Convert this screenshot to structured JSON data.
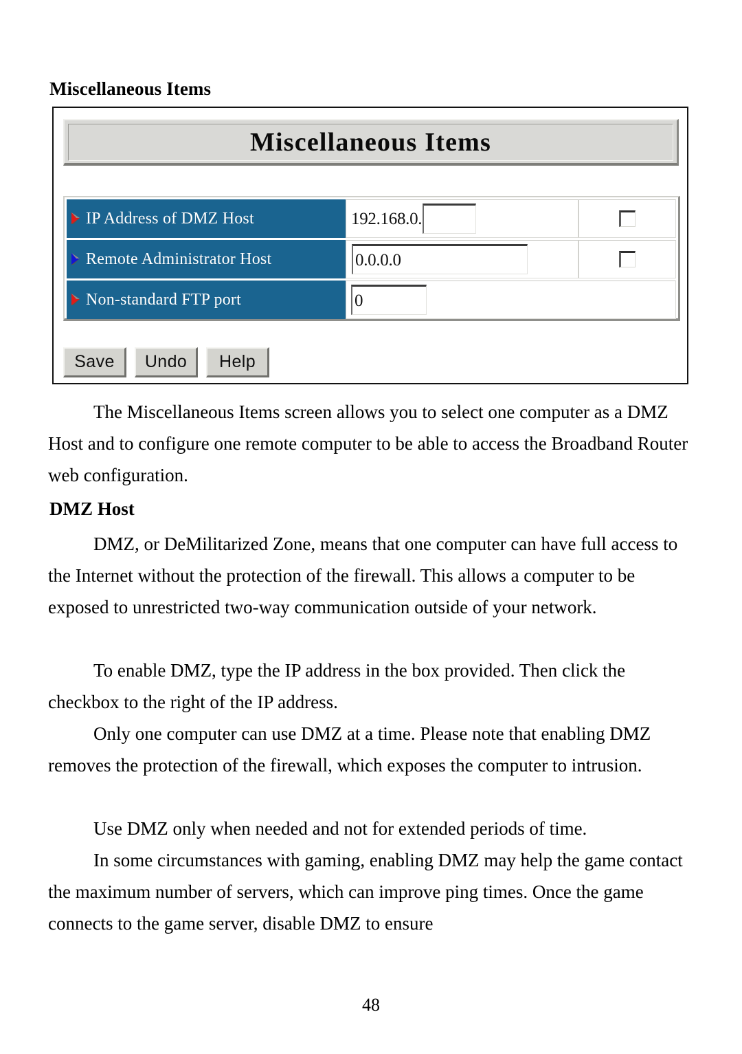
{
  "document": {
    "section_heading": "Miscellaneous Items",
    "page_number": "48"
  },
  "screenshot": {
    "title": "Miscellaneous Items",
    "rows": [
      {
        "bullet_color": "#e01b18",
        "label": "IP Address of DMZ Host",
        "ip_prefix": "192.168.0.",
        "input_value": "",
        "has_checkbox": true,
        "checkbox_checked": false
      },
      {
        "bullet_color": "#1414d2",
        "label": "Remote Administrator Host",
        "ip_prefix": "",
        "input_value": "0.0.0.0",
        "has_checkbox": true,
        "checkbox_checked": false
      },
      {
        "bullet_color": "#e01b18",
        "label": "Non-standard FTP port",
        "ip_prefix": "",
        "input_value": "0",
        "has_checkbox": false,
        "checkbox_checked": false
      }
    ],
    "buttons": [
      {
        "label": "Save"
      },
      {
        "label": "Undo"
      },
      {
        "label": "Help"
      }
    ],
    "colors": {
      "label_cell_blue": "#1a6490",
      "panel_gray": "#d9d9d6",
      "button_face": "#d4d4cf"
    }
  },
  "prose": {
    "intro": "The Miscellaneous Items screen allows you to select one computer as a DMZ Host and to configure one remote computer to be able to access the Broadband Router web configuration.",
    "dmz_heading": "DMZ Host",
    "para1": "DMZ, or DeMilitarized Zone, means that one computer can have full access to the Internet without the protection of the firewall. This allows a computer to be exposed to unrestricted two-way communication outside of your network.",
    "para2": "To enable DMZ, type the IP address in the box provided. Then click the checkbox to the right of the IP address.",
    "para3": "Only one computer can use DMZ at a time. Please note that enabling DMZ removes the protection of the firewall, which exposes the computer to intrusion.",
    "para4": "Use DMZ only when needed and not for extended periods of time.",
    "para5": "In some circumstances with gaming, enabling DMZ may help the game contact the maximum number of servers, which can improve ping times. Once the game connects to the game server, disable DMZ to ensure"
  }
}
